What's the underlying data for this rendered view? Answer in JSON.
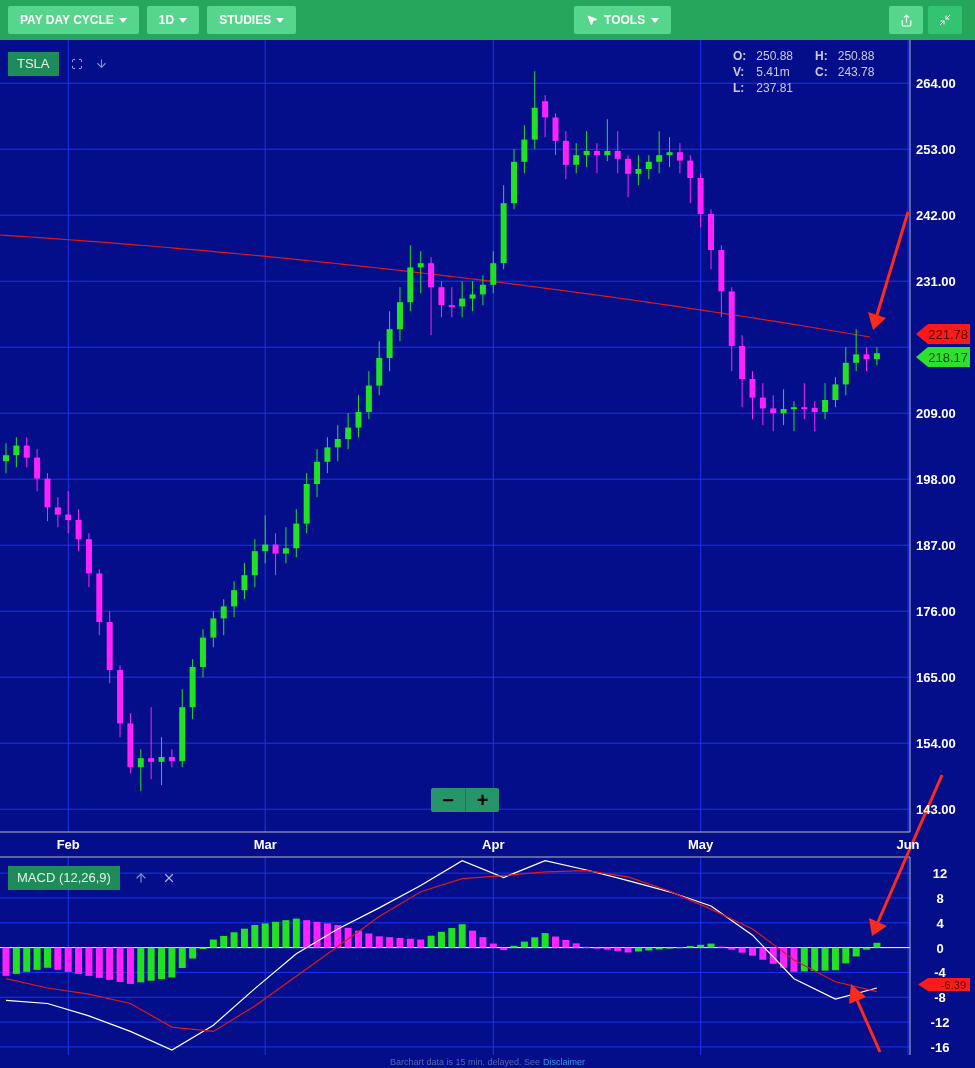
{
  "toolbar": {
    "left_buttons": [
      {
        "label": "PAY DAY CYCLE"
      },
      {
        "label": "1D"
      },
      {
        "label": "STUDIES"
      }
    ],
    "tools_button": {
      "label": "TOOLS"
    },
    "right_buttons": [
      {
        "kind": "share"
      },
      {
        "kind": "collapse"
      }
    ]
  },
  "price_chart": {
    "symbol": "TSLA",
    "quote": [
      {
        "label": "O:",
        "value": "250.88"
      },
      {
        "label": "H:",
        "value": "250.88"
      },
      {
        "label": "V:",
        "value": "5.41m"
      },
      {
        "label": "C:",
        "value": "243.78"
      },
      {
        "label": "L:",
        "value": "237.81"
      }
    ],
    "chart_data": {
      "type": "candlestick",
      "ylim": [
        139.2,
        271.2
      ],
      "categories": [
        null,
        null,
        null,
        null,
        null,
        null,
        "Feb",
        null,
        null,
        null,
        null,
        null,
        null,
        null,
        null,
        null,
        null,
        null,
        null,
        null,
        null,
        null,
        null,
        null,
        null,
        "Mar",
        null,
        null,
        null,
        null,
        null,
        null,
        null,
        null,
        null,
        null,
        null,
        null,
        null,
        null,
        null,
        null,
        null,
        null,
        null,
        null,
        null,
        "Apr",
        null,
        null,
        null,
        null,
        null,
        null,
        null,
        null,
        null,
        null,
        null,
        null,
        null,
        null,
        null,
        null,
        null,
        null,
        null,
        "May",
        null,
        null,
        null,
        null,
        null,
        null,
        null,
        null,
        null,
        null,
        null,
        null,
        null,
        null,
        null,
        null,
        null,
        null,
        null,
        "Jun"
      ],
      "yticks": [
        {
          "value": 264,
          "label": "264.00"
        },
        {
          "value": 253,
          "label": "253.00"
        },
        {
          "value": 242,
          "label": "242.00"
        },
        {
          "value": 231,
          "label": "231.00"
        },
        {
          "value": 209,
          "label": "209.00"
        },
        {
          "value": 198,
          "label": "198.00"
        },
        {
          "value": 187,
          "label": "187.00"
        },
        {
          "value": 176,
          "label": "176.00"
        },
        {
          "value": 165,
          "label": "165.00"
        },
        {
          "value": 154,
          "label": "154.00"
        },
        {
          "value": 143,
          "label": "143.00"
        }
      ],
      "ohlc": [
        [
          201,
          204,
          199,
          202
        ],
        [
          202,
          205,
          200,
          203.6
        ],
        [
          203.6,
          205,
          200,
          201.6
        ],
        [
          201.6,
          203,
          196,
          198.1
        ],
        [
          198.1,
          199,
          191,
          193.3
        ],
        [
          193.3,
          195,
          190,
          192.1
        ],
        [
          192.1,
          196,
          189,
          191.2
        ],
        [
          191.2,
          193,
          186,
          188
        ],
        [
          188,
          189,
          180,
          182.3
        ],
        [
          182.3,
          183,
          172,
          174.2
        ],
        [
          174.2,
          176,
          164,
          166.2
        ],
        [
          166.2,
          167,
          155,
          157.3
        ],
        [
          157.3,
          159,
          149,
          150
        ],
        [
          150,
          153,
          146,
          151.5
        ],
        [
          151.5,
          160,
          148,
          150.9
        ],
        [
          150.9,
          155,
          147,
          151.7
        ],
        [
          151.7,
          153,
          150,
          151
        ],
        [
          151,
          163,
          150,
          160
        ],
        [
          160,
          168,
          158,
          166.7
        ],
        [
          166.7,
          173,
          165,
          171.6
        ],
        [
          171.6,
          176,
          170,
          174.8
        ],
        [
          174.8,
          178,
          172,
          176.8
        ],
        [
          176.8,
          181,
          175,
          179.5
        ],
        [
          179.5,
          184,
          178,
          182
        ],
        [
          182,
          188,
          180,
          186
        ],
        [
          186,
          192,
          184,
          187.1
        ],
        [
          187.1,
          189,
          182,
          185.6
        ],
        [
          185.6,
          190,
          184,
          186.5
        ],
        [
          186.5,
          193,
          185,
          190.6
        ],
        [
          190.6,
          199,
          189,
          197.2
        ],
        [
          197.2,
          203,
          195,
          200.9
        ],
        [
          200.9,
          205,
          199,
          203.3
        ],
        [
          203.3,
          207,
          201,
          204.7
        ],
        [
          204.7,
          209,
          203,
          206.6
        ],
        [
          206.6,
          212,
          205,
          209.2
        ],
        [
          209.2,
          216,
          208,
          213.6
        ],
        [
          213.6,
          221,
          212,
          218.2
        ],
        [
          218.2,
          226,
          216,
          223
        ],
        [
          223,
          230,
          221,
          227.5
        ],
        [
          227.5,
          237,
          226,
          233.3
        ],
        [
          233.3,
          236,
          229,
          234
        ],
        [
          234,
          235,
          222,
          230
        ],
        [
          230,
          231,
          225,
          227
        ],
        [
          227,
          230,
          225,
          226.8
        ],
        [
          226.8,
          231,
          225,
          228.1
        ],
        [
          228.1,
          231,
          226,
          228.8
        ],
        [
          228.8,
          232,
          227,
          230.4
        ],
        [
          230.4,
          236,
          229,
          234
        ],
        [
          234,
          247,
          233,
          244
        ],
        [
          244,
          253,
          243,
          250.9
        ],
        [
          250.9,
          257,
          249,
          254.6
        ],
        [
          254.6,
          266,
          253,
          259.9
        ],
        [
          261,
          262,
          255,
          258.3
        ],
        [
          258.3,
          259,
          252,
          254.4
        ],
        [
          254.4,
          256,
          248,
          250.4
        ],
        [
          250.4,
          254,
          249,
          252
        ],
        [
          252,
          256,
          250,
          252.7
        ],
        [
          252.7,
          254,
          249,
          252
        ],
        [
          252,
          258,
          251,
          252.7
        ],
        [
          252.7,
          256,
          249,
          251.4
        ],
        [
          251.4,
          252,
          245,
          248.9
        ],
        [
          248.9,
          252,
          247,
          249.7
        ],
        [
          249.7,
          252,
          248,
          250.9
        ],
        [
          250.9,
          256,
          249,
          252
        ],
        [
          252,
          255,
          250,
          252.5
        ],
        [
          252.5,
          254,
          249,
          251.1
        ],
        [
          251.1,
          252,
          244,
          248.2
        ],
        [
          248.2,
          249,
          240,
          242.2
        ],
        [
          242.2,
          243,
          233,
          236.2
        ],
        [
          236.2,
          237,
          225,
          229.3
        ],
        [
          229.3,
          230,
          216,
          220.2
        ],
        [
          220.2,
          222,
          210,
          214.7
        ],
        [
          214.7,
          216,
          208,
          211.6
        ],
        [
          211.6,
          214,
          207,
          209.8
        ],
        [
          209.8,
          212,
          206,
          209
        ],
        [
          209,
          213,
          207,
          209.7
        ],
        [
          209.7,
          211,
          206,
          210
        ],
        [
          210,
          214,
          208,
          209.9
        ],
        [
          209.9,
          211,
          206,
          209.2
        ],
        [
          209.2,
          214,
          208,
          211.2
        ],
        [
          211.2,
          215,
          210,
          213.8
        ],
        [
          213.8,
          220,
          212,
          217.4
        ],
        [
          217.4,
          223,
          216,
          218.8
        ],
        [
          218.8,
          220,
          216,
          218
        ],
        [
          218,
          220,
          217,
          219
        ],
        null,
        null,
        null
      ]
    },
    "price_tags": [
      {
        "value": "221.78",
        "color": "#ff1a1a"
      },
      {
        "value": "218.17",
        "color": "#2ee02e"
      }
    ],
    "zoom_buttons": [
      "−",
      "+"
    ]
  },
  "macd": {
    "label": "MACD (12,26,9)",
    "tag": {
      "value": "-6.39",
      "color": "#ff1a1a"
    },
    "chart_data": {
      "type": "line",
      "ylim": [
        -17.3,
        14.6
      ],
      "yticks": [
        12,
        8,
        4,
        0,
        -4,
        -8,
        -12,
        -16
      ],
      "series": [
        {
          "color": "#ffffff",
          "values": [
            -8.5,
            -9,
            -11,
            -13.5,
            -16.5,
            -12.5,
            -6.6,
            -1,
            3,
            6.4,
            10,
            14,
            11.3,
            14,
            12.5,
            10.8,
            9,
            6.7,
            2,
            -5,
            -8.3,
            -6.5
          ]
        },
        {
          "color": "#e01818",
          "values": [
            -5,
            -6.5,
            -7.5,
            -9,
            -12.8,
            -13.5,
            -9.4,
            -4.6,
            0.2,
            5,
            9,
            11.1,
            11.6,
            12.2,
            12.4,
            11.4,
            9.1,
            6.2,
            3,
            -2,
            -5.5,
            -7.1
          ]
        }
      ]
    }
  },
  "footer": {
    "text": "Barchart data is 15 min. delayed. See",
    "link": "Disclaimer"
  }
}
